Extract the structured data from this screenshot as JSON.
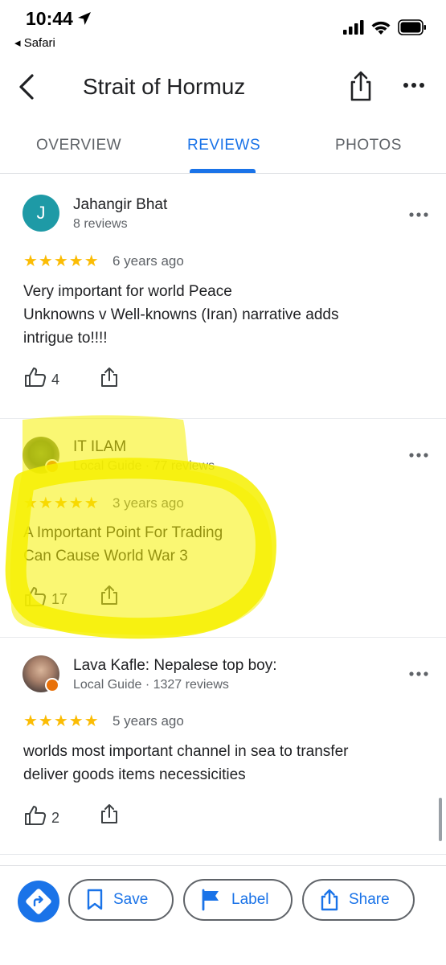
{
  "status_bar": {
    "time": "10:44",
    "back_app": "◂ Safari"
  },
  "header": {
    "title": "Strait of Hormuz"
  },
  "tabs": [
    {
      "label": "OVERVIEW",
      "active": false
    },
    {
      "label": "REVIEWS",
      "active": true
    },
    {
      "label": "PHOTOS",
      "active": false
    }
  ],
  "reviews": [
    {
      "avatar_letter": "J",
      "name": "Jahangir Bhat",
      "meta": "8 reviews",
      "stars": "★★★★★",
      "date": "6 years ago",
      "text_lines": [
        "Very important for world Peace",
        "Unknowns v Well-knowns (Iran) narrative adds",
        "intrigue to!!!!"
      ],
      "likes": "4"
    },
    {
      "name": "IT ILAM",
      "meta": "Local Guide · 77 reviews",
      "stars": "★★★★★",
      "date": "3 years ago",
      "text_lines": [
        "A Important Point For Trading",
        "Can Cause World War 3"
      ],
      "likes": "17"
    },
    {
      "name": "Lava Kafle: Nepalese top boy:",
      "meta": "Local Guide · 1327 reviews",
      "stars": "★★★★★",
      "date": "5 years ago",
      "text_lines": [
        "worlds most important channel in sea to transfer",
        "deliver goods items necessicities"
      ],
      "likes": "2"
    }
  ],
  "bottom_bar": {
    "save": "Save",
    "label": "Label",
    "share": "Share"
  },
  "colors": {
    "accent": "#1a73e8",
    "star": "#fbbc04",
    "highlight": "#f6f000",
    "guide_badge": "#e8710a"
  }
}
